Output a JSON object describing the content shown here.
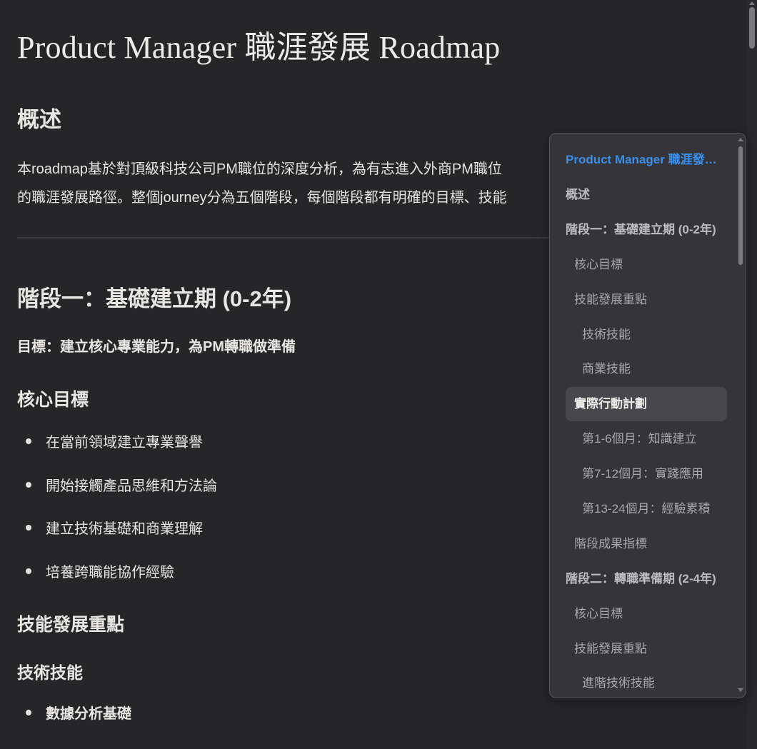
{
  "doc": {
    "title": "Product Manager 職涯發展 Roadmap",
    "overview_heading": "概述",
    "overview_line1": "本roadmap基於對頂級科技公司PM職位的深度分析，為有志進入外商PM職位",
    "overview_line2": "的職涯發展路徑。整個journey分為五個階段，每個階段都有明確的目標、技能",
    "stage1_heading": "階段一：基礎建立期 (0-2年)",
    "stage1_goal": "目標：建立核心專業能力，為PM轉職做準備",
    "core_goals_heading": "核心目標",
    "core_goals": [
      "在當前領域建立專業聲譽",
      "開始接觸產品思維和方法論",
      "建立技術基礎和商業理解",
      "培養跨職能協作經驗"
    ],
    "skills_heading": "技能發展重點",
    "tech_skills_heading": "技術技能",
    "tech_skills": [
      "數據分析基礎"
    ]
  },
  "toc": {
    "items": [
      {
        "label": "Product Manager 職涯發展 Roadmap",
        "level": 1,
        "type": "title"
      },
      {
        "label": "概述",
        "level": 1
      },
      {
        "label": "階段一：基礎建立期 (0-2年)",
        "level": 1
      },
      {
        "label": "核心目標",
        "level": 2
      },
      {
        "label": "技能發展重點",
        "level": 2
      },
      {
        "label": "技術技能",
        "level": 3
      },
      {
        "label": "商業技能",
        "level": 3
      },
      {
        "label": "實際行動計劃",
        "level": 2,
        "active": true
      },
      {
        "label": "第1-6個月：知識建立",
        "level": 3
      },
      {
        "label": "第7-12個月：實踐應用",
        "level": 3
      },
      {
        "label": "第13-24個月：經驗累積",
        "level": 3
      },
      {
        "label": "階段成果指標",
        "level": 2
      },
      {
        "label": "階段二：轉職準備期 (2-4年)",
        "level": 1
      },
      {
        "label": "核心目標",
        "level": 2
      },
      {
        "label": "技能發展重點",
        "level": 2
      },
      {
        "label": "進階技術技能",
        "level": 3
      }
    ]
  },
  "colors": {
    "background": "#262528",
    "toc_background": "#353438",
    "toc_title": "#3b8eea",
    "text": "#e6e4e0"
  }
}
